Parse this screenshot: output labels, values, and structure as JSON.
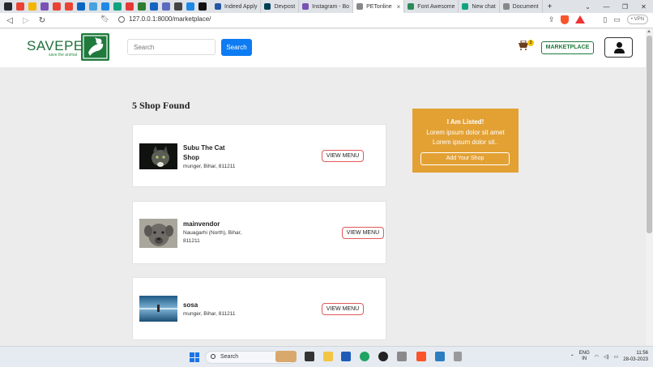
{
  "browser": {
    "tabs": [
      {
        "label": "Indeed Apply",
        "color": "#2557a7"
      },
      {
        "label": "Devpost",
        "color": "#003e54"
      },
      {
        "label": "Instagram - Bo",
        "color": "#7952b3"
      },
      {
        "label": "PETonline",
        "color": "#888888",
        "active": true
      },
      {
        "label": "Font Awesome",
        "color": "#2e8b57"
      },
      {
        "label": "New chat",
        "color": "#10a37f"
      },
      {
        "label": "Document",
        "color": "#888888"
      }
    ],
    "new_tab_label": "+",
    "close_label": "×",
    "url": "127.0.0.1:8000/marketplace/",
    "vpn_label": "• VPN"
  },
  "site": {
    "logo_text": "SAVEPET",
    "logo_tagline": "save the animal",
    "search_placeholder": "Search",
    "search_button": "Search",
    "cart_count": "3",
    "marketplace_button": "MARKETPLACE"
  },
  "results": {
    "title": "5 Shop Found",
    "view_menu_label": "VIEW MENU",
    "shops": [
      {
        "name_line1": "Subu The Cat",
        "name_line2": "Shop",
        "address": "munger, Bihar, 811211"
      },
      {
        "name_line1": "mainvendor",
        "address_line1": "Nauagarhi (North), Bihar,",
        "address_line2": "811211"
      },
      {
        "name_line1": "sosa",
        "address": "munger, Bihar, 811211"
      }
    ]
  },
  "promo": {
    "title": "I Am Listed!",
    "text": "Lorem ipsum dolor sit amet Lorem ipsum dolor sit..",
    "button": "Add Your Shop",
    "color": "#e3a134"
  },
  "taskbar": {
    "search_label": "Search",
    "lang_line1": "ENG",
    "lang_line2": "IN",
    "time": "11:56",
    "date": "28-03-2023"
  }
}
